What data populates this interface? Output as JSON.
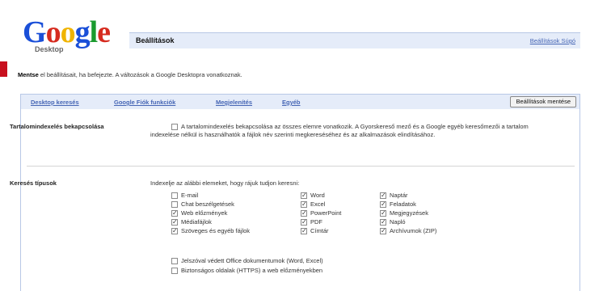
{
  "logo": {
    "text": "Google",
    "sub": "Desktop"
  },
  "header": {
    "title": "Beállítások",
    "help_link": "Beállítások Súgó"
  },
  "notice": {
    "bold": "Mentse",
    "rest": " el beállításait, ha befejezte. A változások a Google Desktopra vonatkoznak."
  },
  "tabs": [
    "Desktop keresés",
    "Google Fiók funkciók",
    "Megjelenítés",
    "Egyéb"
  ],
  "save_button": "Beállítások mentése",
  "indexing": {
    "label": "Tartalomindexelés bekapcsolása",
    "checked": false,
    "text": "A tartalomindexelés bekapcsolása az összes elemre vonatkozik. A Gyorskereső mező és a Google egyéb keresőmezői a tartalom indexelése nélkül is használhatók a fájlok név szerinti megkereséséhez és az alkalmazások elindításához."
  },
  "search_types": {
    "label": "Keresés típusok",
    "intro": "Indexelje az alábbi elemeket, hogy rájuk tudjon keresni:",
    "col1": [
      {
        "label": "E-mail",
        "checked": false
      },
      {
        "label": "Chat beszélgetések",
        "checked": false
      },
      {
        "label": "Web előzmények",
        "checked": true
      },
      {
        "label": "Médiafájlok",
        "checked": true
      },
      {
        "label": "Szöveges és egyéb fájlok",
        "checked": true
      }
    ],
    "col2": [
      {
        "label": "Word",
        "checked": true
      },
      {
        "label": "Excel",
        "checked": true
      },
      {
        "label": "PowerPoint",
        "checked": true
      },
      {
        "label": "PDF",
        "checked": true
      },
      {
        "label": "Címtár",
        "checked": true
      }
    ],
    "col3": [
      {
        "label": "Naptár",
        "checked": true
      },
      {
        "label": "Feladatok",
        "checked": true
      },
      {
        "label": "Megjegyzések",
        "checked": true
      },
      {
        "label": "Napló",
        "checked": true
      },
      {
        "label": "Archívumok (ZIP)",
        "checked": true
      }
    ],
    "extras": [
      {
        "label": "Jelszóval védett Office dokumentumok (Word, Excel)",
        "checked": false
      },
      {
        "label": "Biztonságos oldalak (HTTPS) a web előzményekben",
        "checked": false
      }
    ]
  },
  "colors": {
    "accent_red": "#c8101e",
    "link_blue": "#4666b5",
    "header_bg": "#e5ecf9"
  }
}
